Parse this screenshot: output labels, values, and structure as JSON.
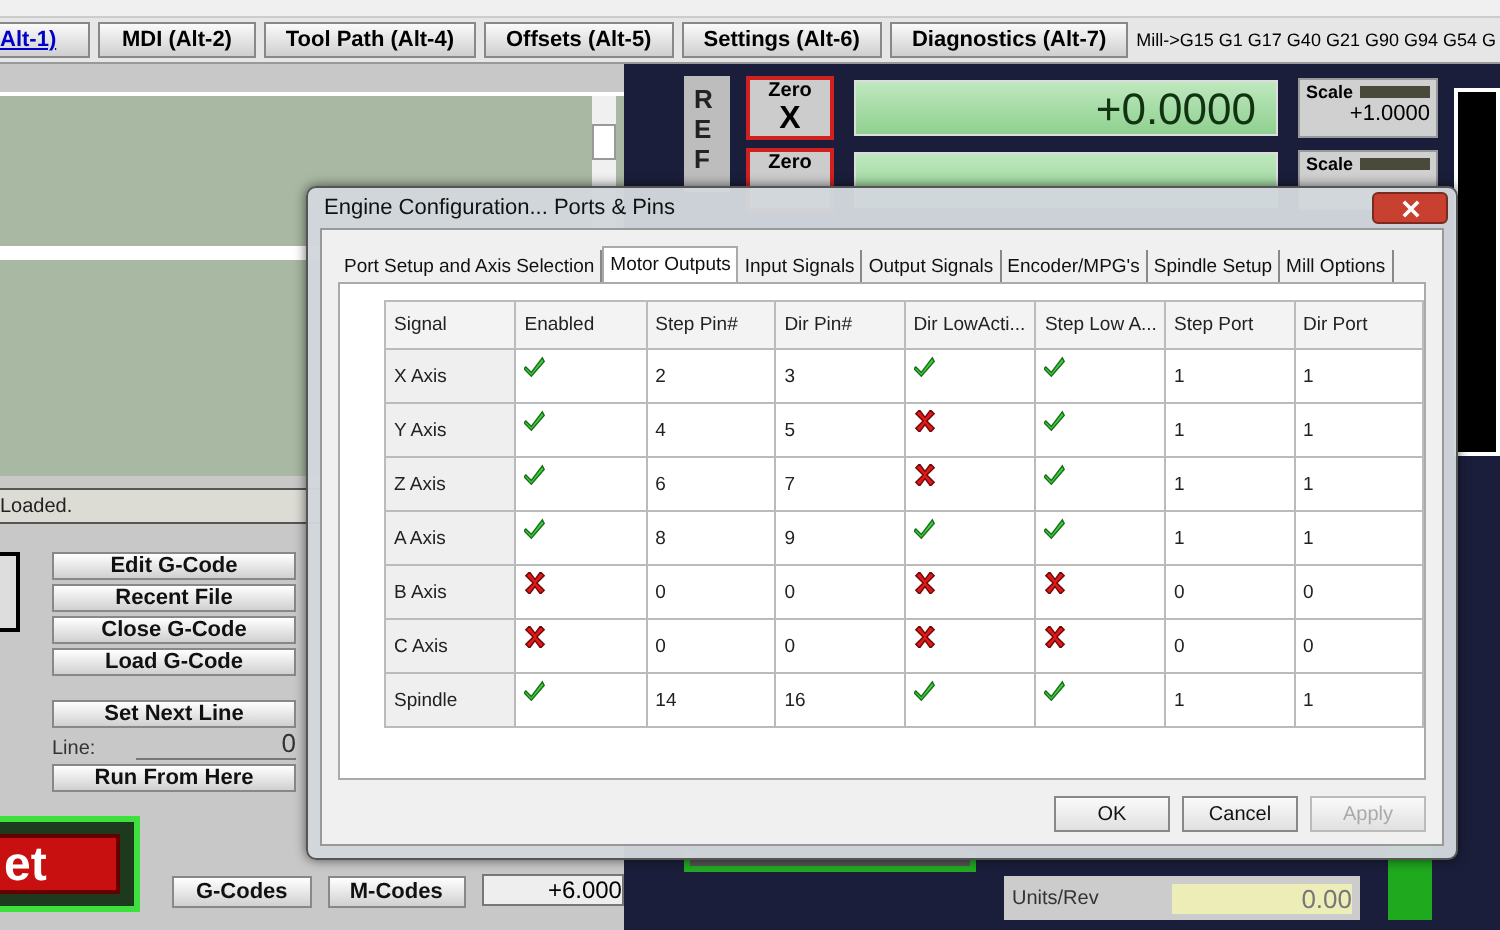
{
  "tabs": [
    {
      "label": "Alt-1)",
      "selected": true
    },
    {
      "label": "MDI (Alt-2)",
      "selected": false
    },
    {
      "label": "Tool Path (Alt-4)",
      "selected": false
    },
    {
      "label": "Offsets (Alt-5)",
      "selected": false
    },
    {
      "label": "Settings (Alt-6)",
      "selected": false
    },
    {
      "label": "Diagnostics (Alt-7)",
      "selected": false
    }
  ],
  "modal_line": "Mill->G15  G1 G17 G40 G21 G90 G94 G54 G",
  "program_panel": {
    "status": "Loaded.",
    "buttons": [
      "Edit G-Code",
      "Recent File",
      "Close G-Code",
      "Load G-Code"
    ],
    "set_next_line": "Set Next Line",
    "line_label": "Line:",
    "line_value": "0",
    "run_from_here": "Run From Here",
    "reset_button": "et",
    "gcodes_button": "G-Codes",
    "mcodes_button": "M-Codes",
    "feed_value": "+6.000"
  },
  "dro": {
    "ref_label": "REF",
    "axes": [
      {
        "zero_label": "Zero",
        "axis": "X",
        "value": "+0.0000",
        "scale_label": "Scale",
        "scale_value": "+1.0000"
      },
      {
        "zero_label": "Zero",
        "scale_label": "Scale"
      }
    ],
    "units_label": "Units/Rev",
    "units_value": "0.00"
  },
  "dialog": {
    "title": "Engine Configuration... Ports & Pins",
    "tabs": [
      {
        "label": "Port Setup and Axis Selection",
        "selected": false
      },
      {
        "label": "Motor Outputs",
        "selected": true
      },
      {
        "label": "Input Signals",
        "selected": false
      },
      {
        "label": "Output Signals",
        "selected": false
      },
      {
        "label": "Encoder/MPG's",
        "selected": false
      },
      {
        "label": "Spindle Setup",
        "selected": false
      },
      {
        "label": "Mill Options",
        "selected": false
      }
    ],
    "table": {
      "columns": [
        "Signal",
        "Enabled",
        "Step Pin#",
        "Dir Pin#",
        "Dir LowActi...",
        "Step Low A...",
        "Step Port",
        "Dir Port"
      ],
      "rows": [
        {
          "signal": "X Axis",
          "enabled": true,
          "step_pin": "2",
          "dir_pin": "3",
          "dir_low_active": true,
          "step_low_active": true,
          "step_port": "1",
          "dir_port": "1"
        },
        {
          "signal": "Y Axis",
          "enabled": true,
          "step_pin": "4",
          "dir_pin": "5",
          "dir_low_active": false,
          "step_low_active": true,
          "step_port": "1",
          "dir_port": "1"
        },
        {
          "signal": "Z Axis",
          "enabled": true,
          "step_pin": "6",
          "dir_pin": "7",
          "dir_low_active": false,
          "step_low_active": true,
          "step_port": "1",
          "dir_port": "1"
        },
        {
          "signal": "A Axis",
          "enabled": true,
          "step_pin": "8",
          "dir_pin": "9",
          "dir_low_active": true,
          "step_low_active": true,
          "step_port": "1",
          "dir_port": "1"
        },
        {
          "signal": "B Axis",
          "enabled": false,
          "step_pin": "0",
          "dir_pin": "0",
          "dir_low_active": false,
          "step_low_active": false,
          "step_port": "0",
          "dir_port": "0"
        },
        {
          "signal": "C Axis",
          "enabled": false,
          "step_pin": "0",
          "dir_pin": "0",
          "dir_low_active": false,
          "step_low_active": false,
          "step_port": "0",
          "dir_port": "0"
        },
        {
          "signal": "Spindle",
          "enabled": true,
          "step_pin": "14",
          "dir_pin": "16",
          "dir_low_active": true,
          "step_low_active": true,
          "step_port": "1",
          "dir_port": "1"
        }
      ]
    },
    "buttons": [
      {
        "label": "OK",
        "disabled": false
      },
      {
        "label": "Cancel",
        "disabled": false
      },
      {
        "label": "Apply",
        "disabled": true
      }
    ]
  }
}
